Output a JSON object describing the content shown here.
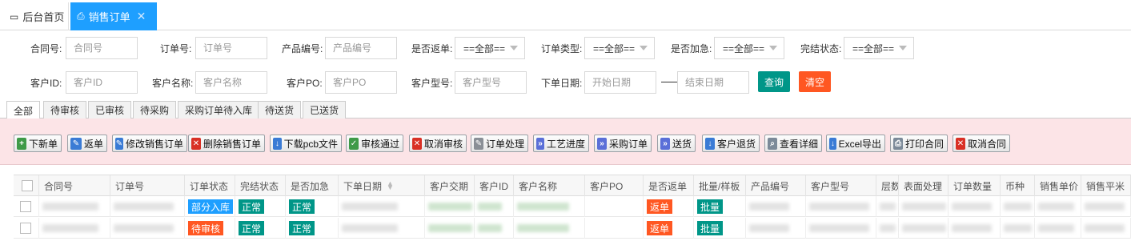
{
  "tabs": {
    "home": "后台首页",
    "active": "销售订单",
    "close": "✕"
  },
  "filters": {
    "row1": [
      {
        "label": "合同号:",
        "placeholder": "合同号"
      },
      {
        "label": "订单号:",
        "placeholder": "订单号"
      },
      {
        "label": "产品编号:",
        "placeholder": "产品编号"
      }
    ],
    "row1_selects": [
      {
        "label": "是否返单:",
        "value": "==全部=="
      },
      {
        "label": "订单类型:",
        "value": "==全部=="
      },
      {
        "label": "是否加急:",
        "value": "==全部=="
      },
      {
        "label": "完结状态:",
        "value": "==全部=="
      }
    ],
    "row2": [
      {
        "label": "客户ID:",
        "placeholder": "客户ID"
      },
      {
        "label": "客户名称:",
        "placeholder": "客户名称"
      },
      {
        "label": "客户PO:",
        "placeholder": "客户PO"
      },
      {
        "label": "客户型号:",
        "placeholder": "客户型号"
      }
    ],
    "date_label": "下单日期:",
    "date_start": "开始日期",
    "date_end": "结束日期",
    "query": "查询",
    "clear": "清空"
  },
  "subtabs": [
    "全部",
    "待审核",
    "已审核",
    "待采购",
    "采购订单待入库",
    "待送货",
    "已送货"
  ],
  "toolbar": [
    {
      "label": "下新单",
      "icon": "new-order-icon",
      "glyph": "+",
      "cls": "ic-green"
    },
    {
      "label": "返单",
      "icon": "edit-icon",
      "glyph": "✎",
      "cls": "ic-blue"
    },
    {
      "label": "修改销售订单",
      "icon": "edit-icon",
      "glyph": "✎",
      "cls": "ic-blue"
    },
    {
      "label": "删除销售订单",
      "icon": "delete-icon",
      "glyph": "✕",
      "cls": "ic-red"
    },
    {
      "label": "下载pcb文件",
      "icon": "download-icon",
      "glyph": "↓",
      "cls": "ic-blue"
    },
    {
      "label": "审核通过",
      "icon": "approve-icon",
      "glyph": "✓",
      "cls": "ic-green"
    },
    {
      "label": "取消审核",
      "icon": "cancel-icon",
      "glyph": "✕",
      "cls": "ic-red"
    },
    {
      "label": "订单处理",
      "icon": "pencil-icon",
      "glyph": "✎",
      "cls": "ic-pencil"
    },
    {
      "label": "工艺进度",
      "icon": "forward-icon",
      "glyph": "»",
      "cls": "ic-circle"
    },
    {
      "label": "采购订单",
      "icon": "forward-icon",
      "glyph": "»",
      "cls": "ic-circle"
    },
    {
      "label": "送货",
      "icon": "forward-icon",
      "glyph": "»",
      "cls": "ic-circle"
    },
    {
      "label": "客户退货",
      "icon": "return-icon",
      "glyph": "↓",
      "cls": "ic-blue"
    },
    {
      "label": "查看详细",
      "icon": "magnifier-icon",
      "glyph": "⌕",
      "cls": "ic-grey"
    },
    {
      "label": "Excel导出",
      "icon": "export-icon",
      "glyph": "↓",
      "cls": "ic-blue"
    },
    {
      "label": "打印合同",
      "icon": "print-icon",
      "glyph": "⎙",
      "cls": "ic-grey"
    },
    {
      "label": "取消合同",
      "icon": "cancel-icon",
      "glyph": "✕",
      "cls": "ic-red"
    }
  ],
  "table": {
    "headers": [
      "合同号",
      "订单号",
      "订单状态",
      "完结状态",
      "是否加急",
      "下单日期",
      "客户交期",
      "客户ID",
      "客户名称",
      "客户PO",
      "是否返单",
      "批量/样板",
      "产品编号",
      "客户型号",
      "层数",
      "表面处理",
      "订单数量",
      "币种",
      "销售单价",
      "销售平米"
    ],
    "rows": [
      {
        "status": "部分入库",
        "status_color": "#1e9fff",
        "done": "正常",
        "urgent": "正常",
        "reorder": "返单",
        "batch": "批量"
      },
      {
        "status": "待审核",
        "status_color": "#ff5722",
        "done": "正常",
        "urgent": "正常",
        "reorder": "返单",
        "batch": "批量"
      }
    ]
  },
  "colors": {
    "accent": "#1e9fff",
    "teal": "#009688",
    "orange": "#ff5722",
    "toolbar_bg": "#fce4e7"
  }
}
